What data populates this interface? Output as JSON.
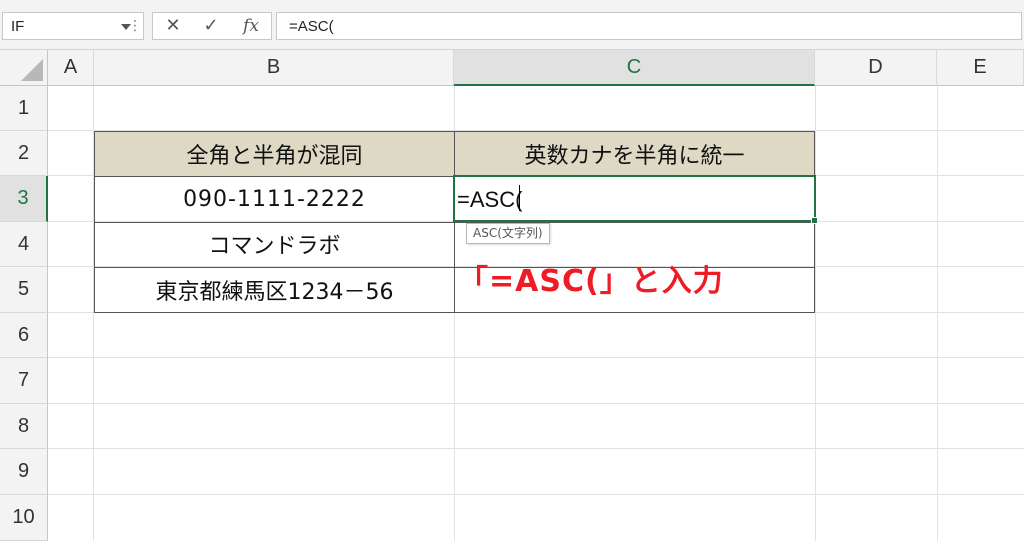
{
  "formula_bar": {
    "name_box": "IF",
    "more_glyph": "⋮",
    "cancel_glyph": "✕",
    "enter_glyph": "✓",
    "fx_glyph": "fx",
    "formula": "=ASC("
  },
  "columns": [
    "A",
    "B",
    "C",
    "D",
    "E"
  ],
  "rows": [
    "1",
    "2",
    "3",
    "4",
    "5",
    "6",
    "7",
    "8",
    "9",
    "10"
  ],
  "table": {
    "header_b": "全角と半角が混同",
    "header_c": "英数カナを半角に統一",
    "b3": "090-1111-2222",
    "b4": "コマンドラボ",
    "b5": "東京都練馬区1234－56"
  },
  "editing": {
    "cell_text": "=ASC(",
    "tooltip": "ASC(文字列)"
  },
  "annotation": "「=ASC(」と入力",
  "colors": {
    "accent": "#217346",
    "header_fill": "#ddd9c4",
    "annotation": "#ee1c25"
  }
}
